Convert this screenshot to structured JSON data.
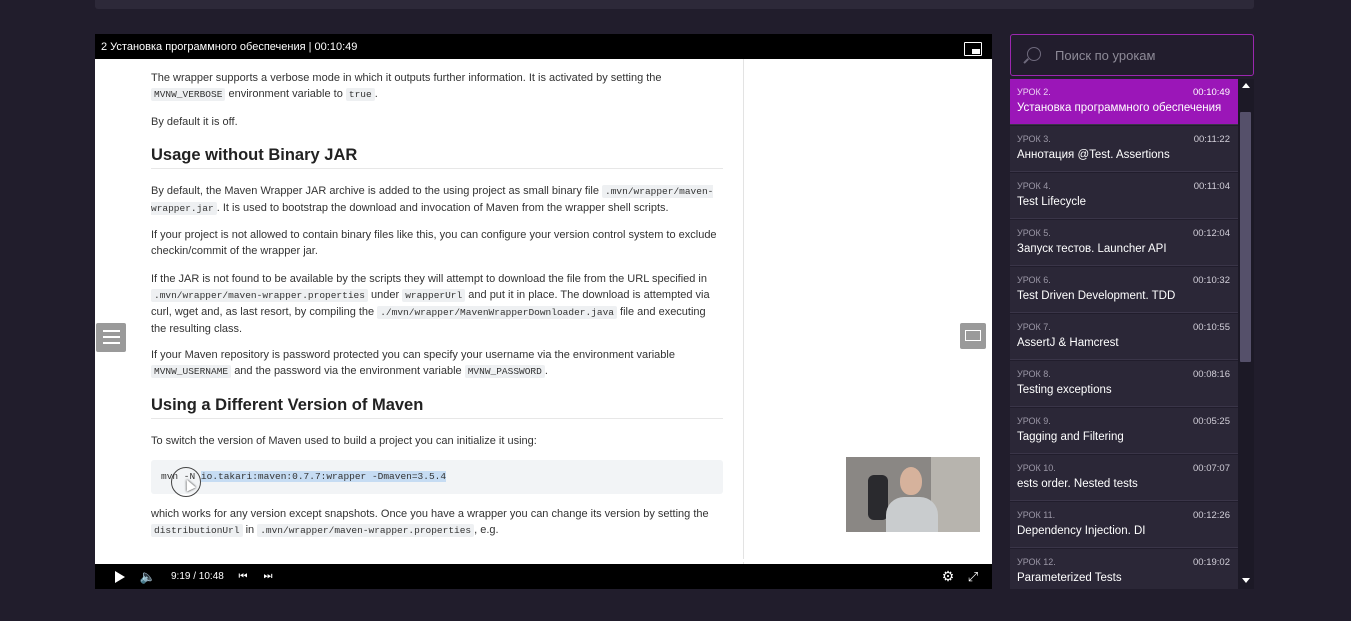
{
  "player": {
    "title": "2 Установка программного обеспечения | 00:10:49",
    "time": "9:19 / 10:48",
    "progress": 0.863,
    "icons": [
      "pip-icon",
      "play-icon",
      "volume-icon",
      "prev-icon",
      "next-icon",
      "gear-icon",
      "fullscreen-icon",
      "list-icon",
      "screen-icon"
    ]
  },
  "doc": {
    "p1_a": "The wrapper supports a verbose mode in which it outputs further information. It is activated by setting the",
    "p1_code1": "MVNW_VERBOSE",
    "p1_b": "environment variable to",
    "p1_code2": "true",
    "p1_c": ".",
    "p2": "By default it is off.",
    "h1": "Usage without Binary JAR",
    "p3_a": "By default, the Maven Wrapper JAR archive is added to the using project as small binary file",
    "p3_code": ".mvn/wrapper/maven-wrapper.jar",
    "p3_b": ". It is used to bootstrap the download and invocation of Maven from the wrapper shell scripts.",
    "p4": "If your project is not allowed to contain binary files like this, you can configure your version control system to exclude checkin/commit of the wrapper jar.",
    "p5_a": "If the JAR is not found to be available by the scripts they will attempt to download the file from the URL specified in",
    "p5_code1": ".mvn/wrapper/maven-wrapper.properties",
    "p5_b": "under",
    "p5_code2": "wrapperUrl",
    "p5_c": "and put it in place. The download is attempted via curl, wget and, as last resort, by compiling the",
    "p5_code3": "./mvn/wrapper/MavenWrapperDownloader.java",
    "p5_d": "file and executing the resulting class.",
    "p6_a": "If your Maven repository is password protected you can specify your username via the environment variable",
    "p6_code1": "MVNW_USERNAME",
    "p6_b": "and the password via the environment variable",
    "p6_code2": "MVNW_PASSWORD",
    "p6_c": ".",
    "h2": "Using a Different Version of Maven",
    "p7": "To switch the version of Maven used to build a project you can initialize it using:",
    "code_plain": "mvn -N ",
    "code_selected": "io.takari:maven:0.7.7:wrapper -Dmaven=3.5.4",
    "p8_a": "which works for any version except snapshots. Once you have a wrapper you can change its version by setting the",
    "p8_code1": "distributionUrl",
    "p8_b": "in",
    "p8_code2": ".mvn/wrapper/maven-wrapper.properties",
    "p8_c": ", e.g."
  },
  "search": {
    "placeholder": "Поиск по урокам"
  },
  "accent_color": "#9b16b8",
  "lessons": [
    {
      "num": "УРОК 2.",
      "duration": "00:10:49",
      "title": "Установка программного обеспечения",
      "active": true
    },
    {
      "num": "УРОК 3.",
      "duration": "00:11:22",
      "title": "Аннотация @Test. Assertions"
    },
    {
      "num": "УРОК 4.",
      "duration": "00:11:04",
      "title": "Test Lifecycle"
    },
    {
      "num": "УРОК 5.",
      "duration": "00:12:04",
      "title": "Запуск тестов. Launcher API"
    },
    {
      "num": "УРОК 6.",
      "duration": "00:10:32",
      "title": "Test Driven Development. TDD"
    },
    {
      "num": "УРОК 7.",
      "duration": "00:10:55",
      "title": "AssertJ & Hamcrest"
    },
    {
      "num": "УРОК 8.",
      "duration": "00:08:16",
      "title": "Testing exceptions"
    },
    {
      "num": "УРОК 9.",
      "duration": "00:05:25",
      "title": "Tagging and Filtering"
    },
    {
      "num": "УРОК 10.",
      "duration": "00:07:07",
      "title": "ests order. Nested tests"
    },
    {
      "num": "УРОК 11.",
      "duration": "00:12:26",
      "title": "Dependency Injection. DI"
    },
    {
      "num": "УРОК 12.",
      "duration": "00:19:02",
      "title": "Parameterized Tests"
    }
  ]
}
